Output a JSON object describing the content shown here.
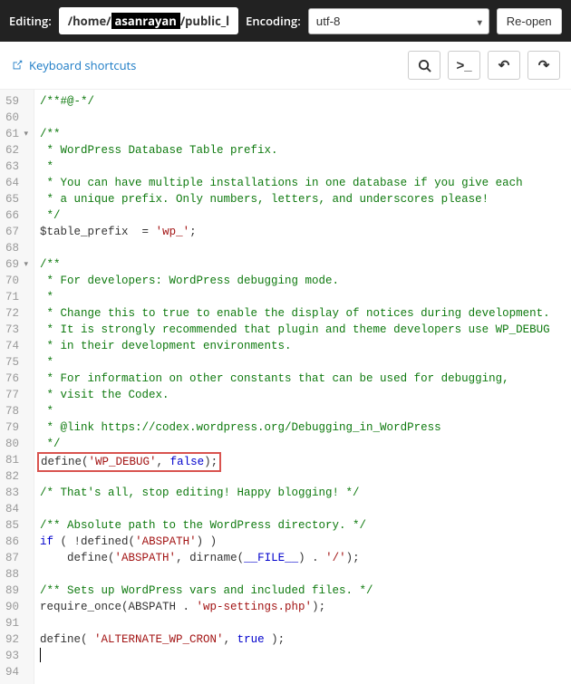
{
  "header": {
    "editing_label": "Editing:",
    "path_prefix": "/home/ ",
    "path_redacted": "asanrayan",
    "path_suffix": "/public_l",
    "encoding_label": "Encoding:",
    "encoding_value": "utf-8",
    "reopen_label": "Re-open"
  },
  "subbar": {
    "keyboard_shortcuts": "Keyboard shortcuts"
  },
  "icons": {
    "search": "search-icon",
    "terminal": ">_",
    "undo": "↶",
    "redo": "↷"
  },
  "code": {
    "lines": [
      {
        "n": 59,
        "html": "<span class='c-comment'>/**#@-*/</span>"
      },
      {
        "n": 60,
        "html": ""
      },
      {
        "n": 61,
        "fold": true,
        "html": "<span class='c-comment'>/**</span>"
      },
      {
        "n": 62,
        "html": "<span class='c-comment'> * WordPress Database Table prefix.</span>"
      },
      {
        "n": 63,
        "html": "<span class='c-comment'> *</span>"
      },
      {
        "n": 64,
        "html": "<span class='c-comment'> * You can have multiple installations in one database if you give each</span>"
      },
      {
        "n": 65,
        "html": "<span class='c-comment'> * a unique prefix. Only numbers, letters, and underscores please!</span>"
      },
      {
        "n": 66,
        "html": "<span class='c-comment'> */</span>"
      },
      {
        "n": 67,
        "html": "<span class='c-var'>$table_prefix</span>  <span class='c-op'>=</span> <span class='c-str'>'wp_'</span>;"
      },
      {
        "n": 68,
        "html": ""
      },
      {
        "n": 69,
        "fold": true,
        "html": "<span class='c-comment'>/**</span>"
      },
      {
        "n": 70,
        "html": "<span class='c-comment'> * For developers: WordPress debugging mode.</span>"
      },
      {
        "n": 71,
        "html": "<span class='c-comment'> *</span>"
      },
      {
        "n": 72,
        "html": "<span class='c-comment'> * Change this to true to enable the display of notices during development.</span>"
      },
      {
        "n": 73,
        "html": "<span class='c-comment'> * It is strongly recommended that plugin and theme developers use WP_DEBUG</span>"
      },
      {
        "n": 74,
        "html": "<span class='c-comment'> * in their development environments.</span>"
      },
      {
        "n": 75,
        "html": "<span class='c-comment'> *</span>"
      },
      {
        "n": 76,
        "html": "<span class='c-comment'> * For information on other constants that can be used for debugging,</span>"
      },
      {
        "n": 77,
        "html": "<span class='c-comment'> * visit the Codex.</span>"
      },
      {
        "n": 78,
        "html": "<span class='c-comment'> *</span>"
      },
      {
        "n": 79,
        "html": "<span class='c-comment'> * @link https://codex.wordpress.org/Debugging_in_WordPress</span>"
      },
      {
        "n": 80,
        "html": "<span class='c-comment'> */</span>"
      },
      {
        "n": 81,
        "highlight": true,
        "html": "<span class='c-func'>define</span>(<span class='c-str'>'WP_DEBUG'</span>, <span class='c-const'>false</span>);"
      },
      {
        "n": 82,
        "html": ""
      },
      {
        "n": 83,
        "html": "<span class='c-comment'>/* That's all, stop editing! Happy blogging! */</span>"
      },
      {
        "n": 84,
        "html": ""
      },
      {
        "n": 85,
        "html": "<span class='c-comment'>/** Absolute path to the WordPress directory. */</span>"
      },
      {
        "n": 86,
        "html": "<span class='c-kw'>if</span> ( !<span class='c-func'>defined</span>(<span class='c-str'>'ABSPATH'</span>) )"
      },
      {
        "n": 87,
        "html": "    <span class='c-func'>define</span>(<span class='c-str'>'ABSPATH'</span>, <span class='c-func'>dirname</span>(<span class='c-const'>__FILE__</span>) . <span class='c-str'>'/'</span>);"
      },
      {
        "n": 88,
        "html": ""
      },
      {
        "n": 89,
        "html": "<span class='c-comment'>/** Sets up WordPress vars and included files. */</span>"
      },
      {
        "n": 90,
        "html": "<span class='c-func'>require_once</span>(ABSPATH . <span class='c-str'>'wp-settings.php'</span>);"
      },
      {
        "n": 91,
        "html": ""
      },
      {
        "n": 92,
        "html": "<span class='c-func'>define</span>( <span class='c-str'>'ALTERNATE_WP_CRON'</span>, <span class='c-const'>true</span> );"
      },
      {
        "n": 93,
        "cursor": true,
        "html": ""
      },
      {
        "n": 94,
        "html": ""
      }
    ]
  }
}
